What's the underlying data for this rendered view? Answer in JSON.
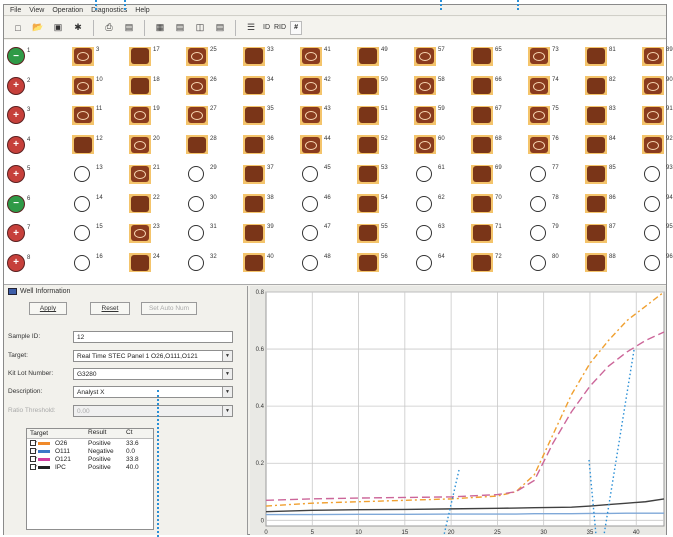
{
  "menu": [
    "File",
    "View",
    "Operation",
    "Diagnostics",
    "Help"
  ],
  "toolbar": {
    "id_label": "ID",
    "rid_label": "RID",
    "hash_label": "#"
  },
  "rows": [
    {
      "label": "1",
      "status": "ok"
    },
    {
      "label": "2",
      "status": "add"
    },
    {
      "label": "3",
      "status": "add"
    },
    {
      "label": "4",
      "status": "add"
    },
    {
      "label": "5",
      "status": "add"
    },
    {
      "label": "6",
      "status": "ok"
    },
    {
      "label": "7",
      "status": "add"
    },
    {
      "label": "8",
      "status": "add"
    }
  ],
  "columns": [
    [
      "curve",
      "curve",
      "curve",
      "fill",
      "empty",
      "empty",
      "empty",
      "empty"
    ],
    [
      "fill",
      "fill",
      "curve",
      "curve",
      "curve",
      "fill",
      "curve",
      "fill"
    ],
    [
      "curve",
      "curve",
      "curve",
      "fill",
      "empty",
      "empty",
      "empty",
      "empty"
    ],
    [
      "fill",
      "fill",
      "fill",
      "fill",
      "fill",
      "fill",
      "fill",
      "fill"
    ],
    [
      "curve",
      "curve",
      "curve",
      "curve",
      "empty",
      "empty",
      "empty",
      "empty"
    ],
    [
      "fill",
      "fill",
      "fill",
      "fill",
      "fill",
      "fill",
      "fill",
      "fill"
    ],
    [
      "curve",
      "curve",
      "curve",
      "curve",
      "empty",
      "empty",
      "empty",
      "empty"
    ],
    [
      "fill",
      "fill",
      "fill",
      "fill",
      "fill",
      "fill",
      "fill",
      "fill"
    ],
    [
      "curve",
      "curve",
      "curve",
      "curve",
      "empty",
      "empty",
      "empty",
      "empty"
    ],
    [
      "fill",
      "fill",
      "fill",
      "fill",
      "fill",
      "fill",
      "fill",
      "fill"
    ],
    [
      "curve",
      "curve",
      "curve",
      "curve",
      "empty",
      "empty",
      "empty",
      "empty"
    ]
  ],
  "well_numbers": [
    [
      "3",
      "10",
      "11",
      "12",
      "13",
      "14",
      "15",
      "16"
    ],
    [
      "17",
      "18",
      "19",
      "20",
      "21",
      "22",
      "23",
      "24"
    ],
    [
      "25",
      "26",
      "27",
      "28",
      "29",
      "30",
      "31",
      "32"
    ],
    [
      "33",
      "34",
      "35",
      "36",
      "37",
      "38",
      "39",
      "40"
    ],
    [
      "41",
      "42",
      "43",
      "44",
      "45",
      "46",
      "47",
      "48"
    ],
    [
      "49",
      "50",
      "51",
      "52",
      "53",
      "54",
      "55",
      "56"
    ],
    [
      "57",
      "58",
      "59",
      "60",
      "61",
      "62",
      "63",
      "64"
    ],
    [
      "65",
      "66",
      "67",
      "68",
      "69",
      "70",
      "71",
      "72"
    ],
    [
      "73",
      "74",
      "75",
      "76",
      "77",
      "78",
      "79",
      "80"
    ],
    [
      "81",
      "82",
      "83",
      "84",
      "85",
      "86",
      "87",
      "88"
    ],
    [
      "89",
      "90",
      "91",
      "92",
      "93",
      "94",
      "95",
      "96"
    ]
  ],
  "well_info": {
    "title": "Well Information",
    "apply": "Apply",
    "reset": "Reset",
    "set_auto": "Set Auto Num",
    "sample_id_label": "Sample ID:",
    "sample_id": "12",
    "target_label": "Target:",
    "target": "Real Time STEC Panel 1 O26,O111,O121",
    "kit_lot_label": "Kit Lot Number:",
    "kit_lot": "G3280",
    "description_label": "Description:",
    "description": "Analyst X",
    "ratio_label": "Ratio Threshold:",
    "ratio": "0.00",
    "table_headers": [
      "Target",
      "Result",
      "Ct"
    ],
    "table_rows": [
      {
        "target": "O26",
        "result": "Positive",
        "ct": "33.6",
        "color": "#f08a2a"
      },
      {
        "target": "O111",
        "result": "Negative",
        "ct": "0.0",
        "color": "#3c78c8"
      },
      {
        "target": "O121",
        "result": "Positive",
        "ct": "33.8",
        "color": "#d03ea0"
      },
      {
        "target": "IPC",
        "result": "Positive",
        "ct": "40.0",
        "color": "#222222"
      }
    ]
  },
  "chart_data": {
    "type": "line",
    "xlim": [
      0,
      43
    ],
    "ylim": [
      -0.02,
      0.8
    ],
    "xticks": [
      0,
      5,
      10,
      15,
      20,
      25,
      30,
      35,
      40
    ],
    "yticks": [
      0,
      0.2,
      0.4,
      0.6,
      0.8
    ],
    "xtick_labels": [
      "0",
      "5",
      "10",
      "15",
      "20",
      "25",
      "30",
      "35",
      "40"
    ],
    "ytick_labels": [
      "0",
      "0.2",
      "0.4",
      "0.6",
      "0.8"
    ],
    "x": [
      0,
      5,
      10,
      15,
      20,
      25,
      27,
      29,
      31,
      33,
      35,
      37,
      39,
      41,
      43
    ],
    "series": [
      {
        "color": "#f0a030",
        "dash": "6,3,2,3",
        "values": [
          0.05,
          0.06,
          0.065,
          0.07,
          0.075,
          0.085,
          0.1,
          0.16,
          0.3,
          0.44,
          0.55,
          0.63,
          0.7,
          0.75,
          0.8
        ]
      },
      {
        "color": "#cc6699",
        "dash": "8,4",
        "values": [
          0.07,
          0.075,
          0.078,
          0.08,
          0.082,
          0.09,
          0.1,
          0.14,
          0.27,
          0.38,
          0.47,
          0.54,
          0.59,
          0.63,
          0.66
        ]
      },
      {
        "color": "#404040",
        "dash": "",
        "values": [
          0.03,
          0.035,
          0.037,
          0.038,
          0.04,
          0.042,
          0.043,
          0.044,
          0.045,
          0.046,
          0.05,
          0.055,
          0.06,
          0.065,
          0.075
        ]
      },
      {
        "color": "#7fa8d8",
        "dash": "",
        "values": [
          0.02,
          0.02,
          0.021,
          0.021,
          0.022,
          0.022,
          0.022,
          0.023,
          0.023,
          0.023,
          0.024,
          0.024,
          0.025,
          0.025,
          0.025
        ]
      }
    ]
  }
}
